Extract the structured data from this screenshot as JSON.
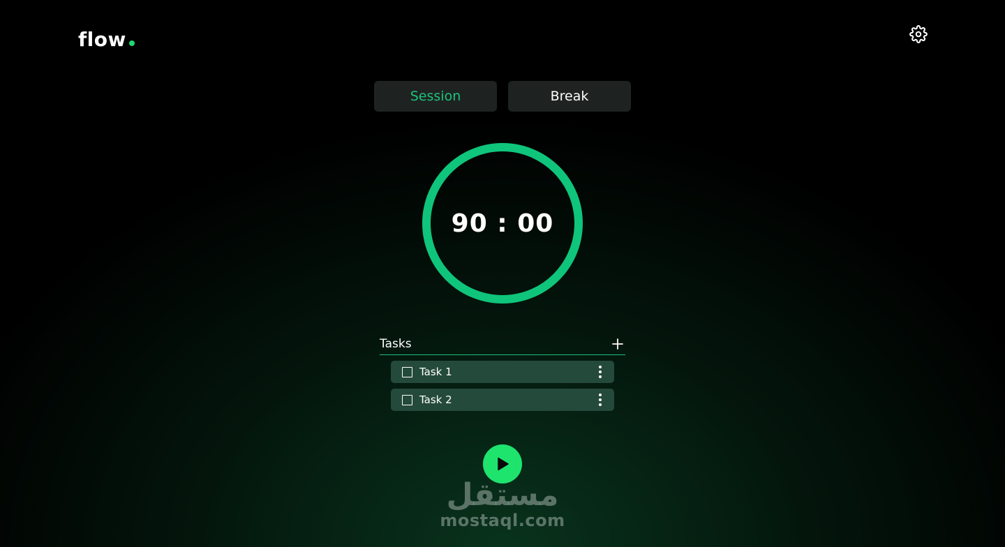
{
  "header": {
    "logo_text": "flow",
    "accent_color": "#1ed874",
    "settings_icon": "gear-icon"
  },
  "mode_tabs": [
    {
      "label": "Session",
      "active": true
    },
    {
      "label": "Break",
      "active": false
    }
  ],
  "timer": {
    "display": "90 : 00",
    "progress": 1.0,
    "ring_color": "#0fc57b"
  },
  "tasks": {
    "title": "Tasks",
    "add_icon": "plus-icon",
    "items": [
      {
        "label": "Task 1",
        "checked": false
      },
      {
        "label": "Task 2",
        "checked": false
      }
    ]
  },
  "controls": {
    "play_icon": "play-icon",
    "play_color": "#1ee46e"
  },
  "watermark": {
    "arabic": "مستقل",
    "latin": "mostaql.com"
  }
}
